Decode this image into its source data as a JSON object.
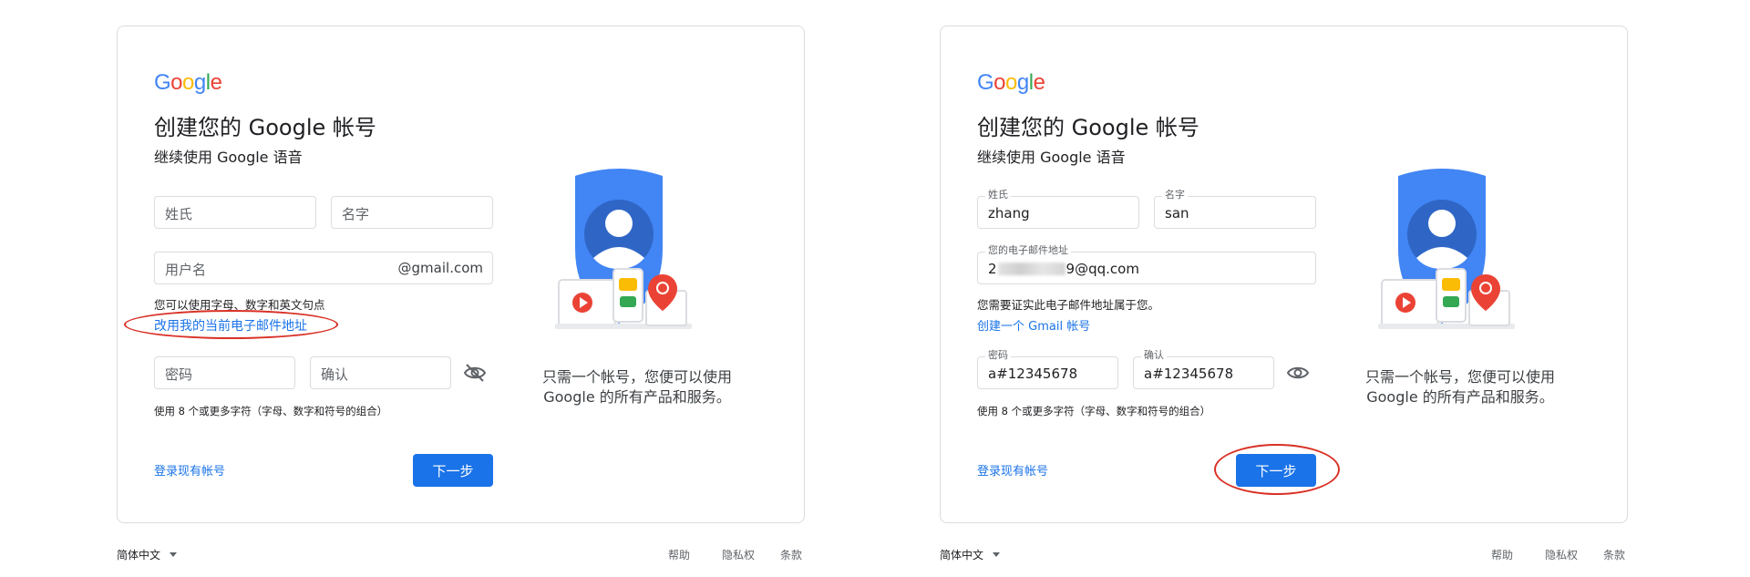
{
  "brand": {
    "letters": [
      "G",
      "o",
      "o",
      "g",
      "l",
      "e"
    ],
    "colors": [
      "#4285F4",
      "#EA4335",
      "#FBBC05",
      "#4285F4",
      "#34A853",
      "#EA4335"
    ]
  },
  "left": {
    "title": "创建您的 Google 帐号",
    "subtitle": "继续使用 Google 语音",
    "last_name_placeholder": "姓氏",
    "first_name_placeholder": "名字",
    "username_placeholder": "用户名",
    "username_suffix": "@gmail.com",
    "username_hint": "您可以使用字母、数字和英文句点",
    "use_current_email_link": "改用我的当前电子邮件地址",
    "password_placeholder": "密码",
    "confirm_placeholder": "确认",
    "password_hint": "使用 8 个或更多字符（字母、数字和符号的组合）",
    "signin_link": "登录现有帐号",
    "next_button": "下一步",
    "caption_line1": "只需一个帐号，您便可以使用",
    "caption_line2": "Google 的所有产品和服务。",
    "footer_language": "简体中文",
    "footer_help": "帮助",
    "footer_privacy": "隐私权",
    "footer_terms": "条款"
  },
  "right": {
    "title": "创建您的 Google 帐号",
    "subtitle": "继续使用 Google 语音",
    "last_name_label": "姓氏",
    "last_name_value": "zhang",
    "first_name_label": "名字",
    "first_name_value": "san",
    "email_label": "您的电子邮件地址",
    "email_value_prefix": "2",
    "email_value_suffix": "9@qq.com",
    "email_hint": "您需要证实此电子邮件地址属于您。",
    "create_gmail_link": "创建一个 Gmail 帐号",
    "password_label": "密码",
    "password_value": "a#12345678",
    "confirm_label": "确认",
    "confirm_value": "a#12345678",
    "password_hint": "使用 8 个或更多字符（字母、数字和符号的组合）",
    "signin_link": "登录现有帐号",
    "next_button": "下一步",
    "caption_line1": "只需一个帐号，您便可以使用",
    "caption_line2": "Google 的所有产品和服务。",
    "footer_language": "简体中文",
    "footer_help": "帮助",
    "footer_privacy": "隐私权",
    "footer_terms": "条款"
  },
  "colors": {
    "accent": "#1a73e8",
    "annotation_red": "#d93025",
    "border": "#dadce0"
  },
  "icons": [
    "google-logo",
    "shield-icon",
    "user-avatar-icon",
    "play-icon",
    "chat-icon",
    "map-pin-icon",
    "eye-off-icon",
    "eye-icon",
    "chevron-down-icon"
  ]
}
